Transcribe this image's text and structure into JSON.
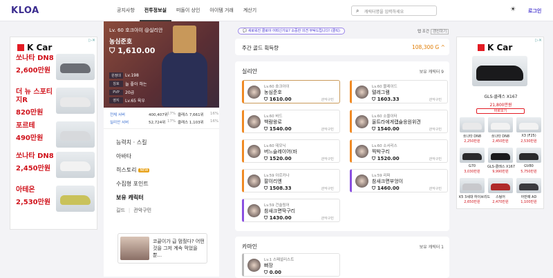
{
  "app": {
    "logo": "KLOA"
  },
  "nav": {
    "items": [
      "공지사항",
      "전투정보실",
      "떠돌이 상인",
      "아이템 거래",
      "계산기"
    ],
    "active": 1,
    "search_placeholder": "캐릭터명을 입력하세요",
    "login": "로그인"
  },
  "ad_left": {
    "brand": "K Car",
    "cars": [
      {
        "name": "쏘나타 DN8",
        "price": "2,600만원",
        "color": "#6b6e75"
      },
      {
        "name": "더 뉴 스포티지R",
        "price": "820만원",
        "color": "#e9e9ea"
      },
      {
        "name": "포르테",
        "price": "490만원",
        "color": "#d7d9dc"
      },
      {
        "name": "쏘나타 DN8",
        "price": "2,450만원",
        "color": "#f2f2f2"
      },
      {
        "name": "아테온",
        "price": "2,530만원",
        "color": "#c9c25a"
      }
    ]
  },
  "profile": {
    "level_line": "Lv. 60 호크아이 @실리안",
    "nickname": "농심준호",
    "item_level": "1,610.00",
    "stats": [
      {
        "k": "원정대",
        "v": "Lv.198"
      },
      {
        "k": "칭호",
        "v": "늘 좋아 하는"
      },
      {
        "k": "PVP",
        "v": "20급"
      },
      {
        "k": "영지",
        "v": "Lv.65 육우"
      }
    ],
    "ranks": [
      {
        "label": "전체 서버",
        "rank": "400,407위",
        "pct": "17%",
        "cls_label": "클래스 7,661위",
        "cls_pct": "16%"
      },
      {
        "label": "실리안 서버",
        "rank": "52,724위",
        "pct": "17%",
        "cls_label": "클래스 1,103위",
        "cls_pct": "16%"
      }
    ],
    "menu": [
      {
        "label": "능력치 · 스킬"
      },
      {
        "label": "아바타"
      },
      {
        "label": "히스토리",
        "badge": "NEW"
      },
      {
        "label": "수집형 포인트"
      },
      {
        "label": "보유 캐릭터"
      }
    ],
    "submenu": [
      "길드",
      "관악구민"
    ],
    "recommend_text": "코끝이가 급 멈췄다? 어떤것을 그저 계속 먹었을뿐..."
  },
  "main": {
    "notice": "새로워진 클로아 어떠신가요? 소중한 의견 부탁드립니다! (클릭)",
    "options_label": "탭 조건",
    "options_btn": "갱신하기",
    "weekly_title": "주간 골드 획득량",
    "weekly_gold": "108,300 G ^",
    "servers": [
      {
        "name": "실리안",
        "count": "보유 캐릭터 9",
        "chars": [
          {
            "lv": "Lv.60 호크아이",
            "name": "농심준호",
            "ilvl": "1610.00",
            "guild": "관악구민",
            "accent": "orange",
            "selected": true
          },
          {
            "lv": "Lv.60 블레이드",
            "name": "텔레그램",
            "ilvl": "1603.33",
            "guild": "관악구민",
            "accent": "orange"
          },
          {
            "lv": "Lv.60 바드",
            "name": "백람왕로",
            "ilvl": "1540.00",
            "guild": "관악구민",
            "accent": "orange"
          },
          {
            "lv": "Lv.60 소울이터",
            "name": "울트라에게캡슐응원위견",
            "ilvl": "1540.00",
            "guild": "관악구민",
            "accent": "orange"
          },
          {
            "lv": "Lv.60 데모닉",
            "name": "버느슬레이어(바",
            "ilvl": "1520.00",
            "guild": "관악구민",
            "accent": "orange"
          },
          {
            "lv": "Lv.60 소서리스",
            "name": "찍박구리",
            "ilvl": "1520.00",
            "guild": "관악구민",
            "accent": "orange"
          },
          {
            "lv": "Lv.59 아르카나",
            "name": "팔이리엔",
            "ilvl": "1508.33",
            "guild": "관악구민",
            "accent": "orange"
          },
          {
            "lv": "Lv.59 리퍼",
            "name": "참새크면부엉이",
            "ilvl": "1460.00",
            "guild": "관악구민",
            "accent": "purple"
          },
          {
            "lv": "Lv.59 건슬링어",
            "name": "참새크면딱구리",
            "ilvl": "1430.00",
            "guild": "관악구민",
            "accent": "purple"
          }
        ]
      },
      {
        "name": "카마인",
        "count": "보유 캐릭터 1",
        "chars": [
          {
            "lv": "Lv.1 스페셜리스트",
            "name": "뻐장",
            "ilvl": "0.00",
            "guild": "",
            "accent": "gray"
          }
        ]
      }
    ]
  },
  "ad_right": {
    "brand": "K Car",
    "feature_name": "GLS-클래스 X167",
    "feature_price": "21,800만원",
    "button": "바로보기",
    "grid": [
      {
        "name": "쏘나타 DN8",
        "price": "2,250만원",
        "color": "#e9e9ea"
      },
      {
        "name": "쏘나타 DN8",
        "price": "2,450만원",
        "color": "#f2f2f2"
      },
      {
        "name": "X3 (F25)",
        "price": "2,530만원",
        "color": "#f2f2f2"
      },
      {
        "name": "G70",
        "price": "3,030만원",
        "color": "#2a2a2c"
      },
      {
        "name": "GLS-클래스 X167",
        "price": "9,990만원",
        "color": "#1a1a1c"
      },
      {
        "name": "GV80",
        "price": "5,750만원",
        "color": "#2a2a2c"
      },
      {
        "name": "K5 3세대 하이브리드",
        "price": "2,650만원",
        "color": "#c8c8cc"
      },
      {
        "name": "스팅어",
        "price": "2,470만원",
        "color": "#b02a2a"
      },
      {
        "name": "아반떼 AD",
        "price": "1,100만원",
        "color": "#3a3a3e"
      }
    ]
  }
}
